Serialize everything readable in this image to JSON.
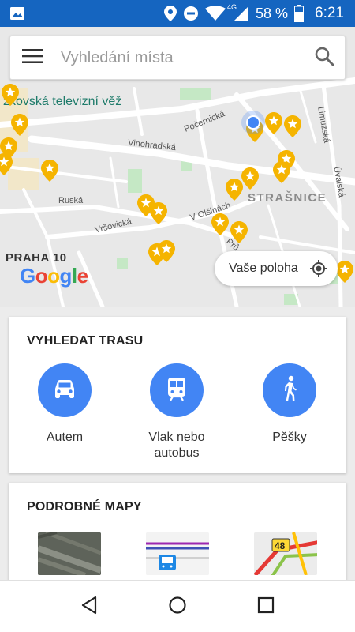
{
  "status_bar": {
    "battery": "58 %",
    "time": "6:21",
    "network": "4G",
    "icons": [
      "image-icon",
      "location-icon",
      "dnd-icon",
      "wifi-icon",
      "signal-icon",
      "battery-icon"
    ]
  },
  "search": {
    "placeholder": "Vyhledání místa",
    "menu_icon": "menu-icon",
    "search_icon": "search-icon"
  },
  "map": {
    "labels": {
      "tower": "žkovská televizní věž",
      "pocernicka": "Počernická",
      "limuzska": "Limuzská",
      "vinohradska": "Vinohradská",
      "russka": "Ruská",
      "v_olsinach": "V Olšinách",
      "strasnice": "STRAŠNICE",
      "uvalska": "Úvalská",
      "vrsovicka": "Vršovická",
      "pru": "Prů",
      "praha10": "PRAHA 10"
    },
    "logo": "Google",
    "my_location_label": "Vaše poloha"
  },
  "route_card": {
    "title": "VYHLEDAT TRASU",
    "modes": [
      {
        "label": "Autem",
        "icon": "car-icon"
      },
      {
        "label": "Vlak nebo autobus",
        "icon": "train-icon"
      },
      {
        "label": "Pěšky",
        "icon": "walk-icon"
      }
    ]
  },
  "maps_card": {
    "title": "PODROBNÉ MAPY",
    "traffic_badge": "48"
  },
  "colors": {
    "status_bar": "#1565c0",
    "accent": "#4285f4",
    "pin": "#f5b400",
    "park": "#c5e8c5"
  }
}
